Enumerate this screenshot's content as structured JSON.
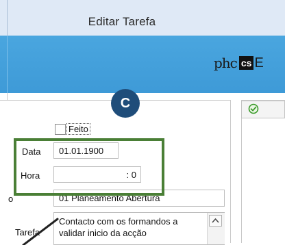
{
  "window": {
    "title": "Editar Tarefa"
  },
  "logo": {
    "part1": "phc",
    "part2": "cs",
    "part3": "E"
  },
  "badge": {
    "letter": "C"
  },
  "form": {
    "feito_label": "Feito",
    "feito_checked": false,
    "data_label": "Data",
    "data_value": "01.01.1900",
    "hora_label": "Hora",
    "hora_value": ": 0",
    "fase_label_fragment": "o",
    "fase_value": "01 Planeamento Abertura",
    "tarefa_label": "Tarefa",
    "tarefa_value": "Contacto com os formandos a validar inicio da acção"
  },
  "colors": {
    "banner": "#3e9ad7",
    "highlight": "#4a7f36",
    "badge": "#1f4d7a",
    "ok_icon": "#3a9a2a"
  },
  "icons": {
    "ok": "check-circle-icon",
    "scroll_up": "chevron-up-icon"
  }
}
